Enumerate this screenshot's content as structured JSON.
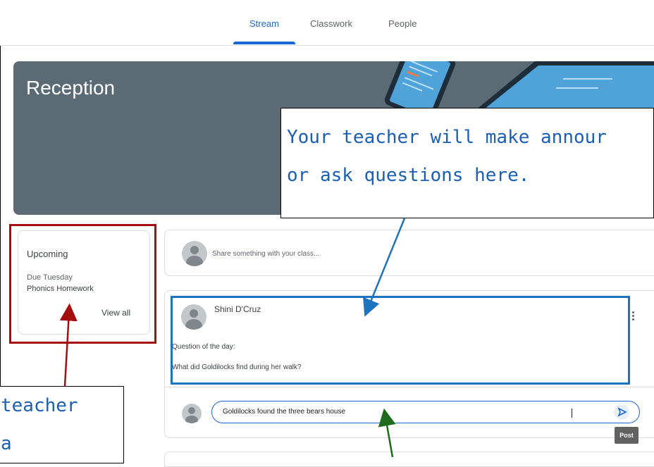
{
  "tabs": [
    {
      "label": "Stream",
      "active": true
    },
    {
      "label": "Classwork",
      "active": false
    },
    {
      "label": "People",
      "active": false
    }
  ],
  "banner": {
    "title": "Reception",
    "color": "#5b6b75"
  },
  "upcoming": {
    "title": "Upcoming",
    "due": "Due Tuesday",
    "item": "Phonics Homework",
    "view_all": "View all"
  },
  "share": {
    "placeholder": "Share something with your class..."
  },
  "post": {
    "author": "Shini D'Cruz",
    "line1": "Question of the day:",
    "line2": "What did Goldilocks find during her walk?",
    "menu_icon": "more-vert-icon"
  },
  "reply": {
    "value": "Goldilocks found the three bears house",
    "send_icon": "send-icon",
    "tooltip": "Post"
  },
  "annotations": {
    "main_line1": "Your teacher will make annour",
    "main_line2": "or ask questions here.",
    "left_line1": "teacher",
    "left_line2": "a"
  },
  "colors": {
    "accent": "#1967d2",
    "red": "#a50e0e",
    "blue": "#1e73be",
    "green": "#1e6b1e"
  }
}
